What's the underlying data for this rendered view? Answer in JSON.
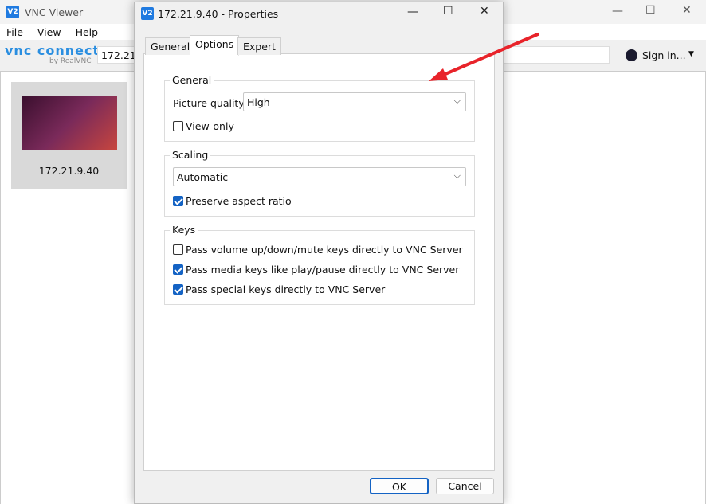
{
  "main_window": {
    "title": "VNC Viewer",
    "app_icon": "V2",
    "menu": [
      "File",
      "View",
      "Help"
    ],
    "logo": "vnc connect",
    "logo_sub": "by RealVNC",
    "address_value": "172.21.9.40",
    "sign_in": "Sign in...",
    "connections": [
      {
        "label": "172.21.9.40"
      }
    ]
  },
  "dialog": {
    "title": "172.21.9.40 - Properties",
    "tabs": [
      "General",
      "Options",
      "Expert"
    ],
    "active_tab": "Options",
    "general": {
      "label": "General",
      "picture_quality_label": "Picture quality:",
      "picture_quality_value": "High",
      "view_only": {
        "label": "View-only",
        "checked": false
      }
    },
    "scaling": {
      "label": "Scaling",
      "value": "Automatic",
      "preserve": {
        "label": "Preserve aspect ratio",
        "checked": true
      }
    },
    "keys": {
      "label": "Keys",
      "items": [
        {
          "label": "Pass volume up/down/mute keys directly to VNC Server",
          "checked": false
        },
        {
          "label": "Pass media keys like play/pause directly to VNC Server",
          "checked": true
        },
        {
          "label": "Pass special keys directly to VNC Server",
          "checked": true
        }
      ]
    },
    "ok": "OK",
    "cancel": "Cancel"
  },
  "annotation": {
    "color": "#e8232a"
  }
}
